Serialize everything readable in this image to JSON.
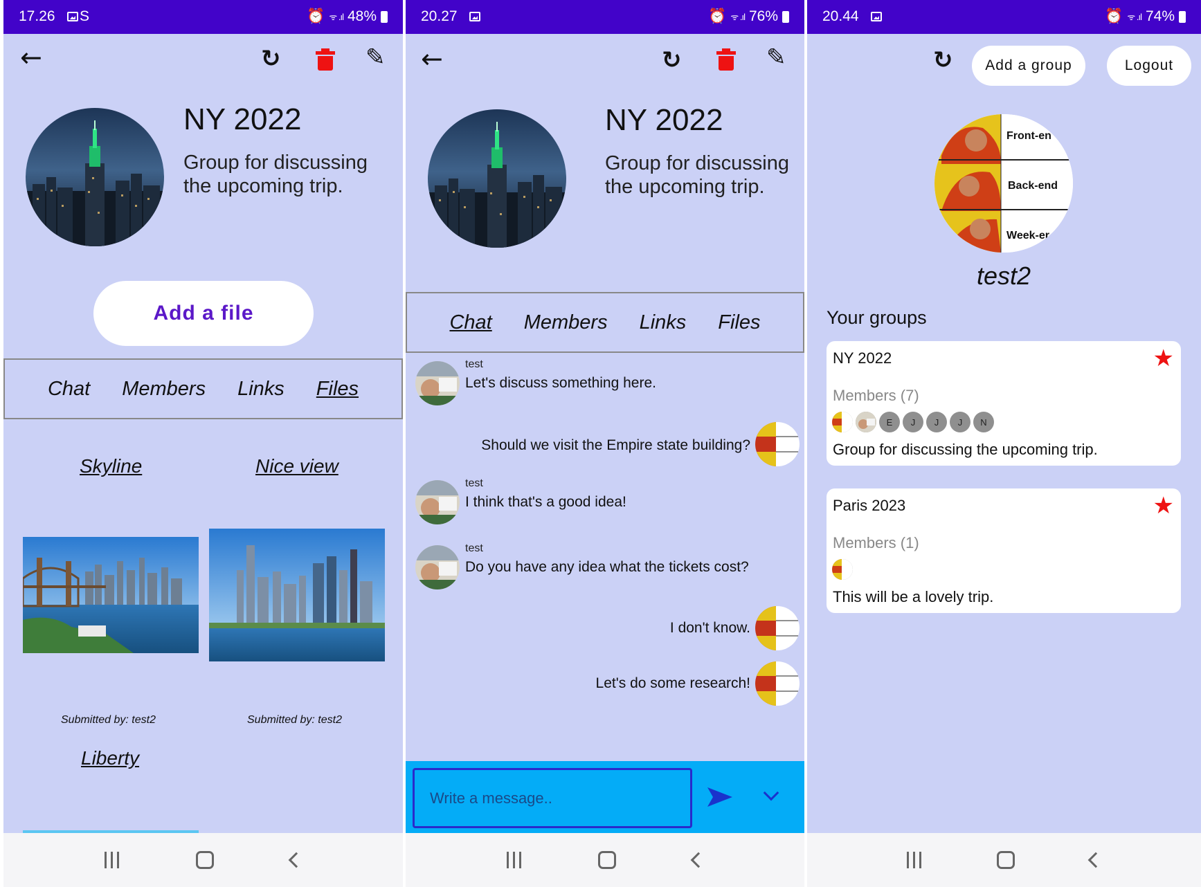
{
  "colors": {
    "screen_bg": "#cbd1f6",
    "statusbar": "#4203c9",
    "accent_purple": "#5b18c8",
    "composer": "#04acf7",
    "delete_red": "#ee1212"
  },
  "screen1": {
    "status": {
      "time": "17.26",
      "extra_icon": "S",
      "battery": "48%"
    },
    "toolbar": {
      "back_icon": "arrow-left-icon",
      "refresh_icon": "refresh-icon",
      "delete_icon": "trash-icon",
      "edit_icon": "pencil-icon"
    },
    "group": {
      "title": "NY 2022",
      "description": "Group for discussing the upcoming trip."
    },
    "add_file_label": "Add a file",
    "tabs": [
      {
        "label": "Chat"
      },
      {
        "label": "Members"
      },
      {
        "label": "Links"
      },
      {
        "label": "Files",
        "active": true
      }
    ],
    "files": [
      {
        "name": "Skyline",
        "submitted": "Submitted by: test2"
      },
      {
        "name": "Nice view",
        "submitted": "Submitted by: test2"
      },
      {
        "name": "Liberty"
      }
    ]
  },
  "screen2": {
    "status": {
      "time": "20.27",
      "battery": "76%"
    },
    "group": {
      "title": "NY 2022",
      "description": "Group for discussing the upcoming trip."
    },
    "tabs": [
      {
        "label": "Chat",
        "active": true
      },
      {
        "label": "Members"
      },
      {
        "label": "Links"
      },
      {
        "label": "Files"
      }
    ],
    "messages": [
      {
        "author": "test",
        "text": "Let's discuss something here.",
        "side": "left"
      },
      {
        "author": "",
        "text": "Should we visit the Empire state building?",
        "side": "right"
      },
      {
        "author": "test",
        "text": "I think that's a good idea!",
        "side": "left"
      },
      {
        "author": "test",
        "text": "Do you have any idea what the tickets cost?",
        "side": "left"
      },
      {
        "author": "",
        "text": "I don't know.",
        "side": "right"
      },
      {
        "author": "",
        "text": "Let's do some research!",
        "side": "right"
      }
    ],
    "composer": {
      "placeholder": "Write a message..",
      "send_icon": "send-icon",
      "expand_icon": "chevron-down-icon"
    }
  },
  "screen3": {
    "status": {
      "time": "20.44",
      "battery": "74%"
    },
    "header": {
      "refresh_icon": "refresh-icon",
      "add_group_label": "Add a group",
      "logout_label": "Logout"
    },
    "profile": {
      "meme_labels": [
        "Front-en",
        "Back-end",
        "Week-er"
      ],
      "username": "test2"
    },
    "section_title": "Your groups",
    "groups": [
      {
        "title": "NY 2022",
        "members_label": "Members (7)",
        "member_initials": [
          "E",
          "J",
          "J",
          "J",
          "N"
        ],
        "description": "Group for discussing the upcoming trip.",
        "favorite": true
      },
      {
        "title": "Paris 2023",
        "members_label": "Members (1)",
        "member_initials": [],
        "description": "This will be a lovely trip.",
        "favorite": true
      }
    ]
  }
}
